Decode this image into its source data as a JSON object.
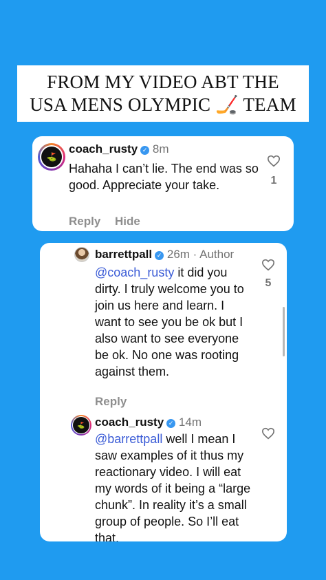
{
  "title": {
    "line1": "FROM MY VIDEO ABT THE",
    "line2": "USA MENS OLYMPIC 🏒 TEAM"
  },
  "comments": [
    {
      "username": "coach_rusty",
      "time": "8m",
      "text": "Hahaha I can’t lie. The end was so good. Appreciate your take.",
      "likes": "1",
      "actions": [
        "Reply",
        "Hide"
      ]
    },
    {
      "username": "barrettpall",
      "time": "26m",
      "author_label": "Author",
      "mention": "@coach_rusty",
      "text": " it did you dirty. I truly welcome you to join us here and learn. I want to see you be ok but I also want to see everyone be ok. No one was rooting against them.",
      "likes": "5",
      "actions": [
        "Reply"
      ]
    },
    {
      "username": "coach_rusty",
      "time": "14m",
      "mention": "@barrettpall",
      "text": " well I mean I saw examples of it thus my reactionary video. I will eat my words of it being a “large chunk”. In reality it’s a small group of people. So I’ll eat that."
    }
  ],
  "colors": {
    "background": "#1f9bf0",
    "mention": "#3a5bd6",
    "verified": "#3897f0"
  }
}
